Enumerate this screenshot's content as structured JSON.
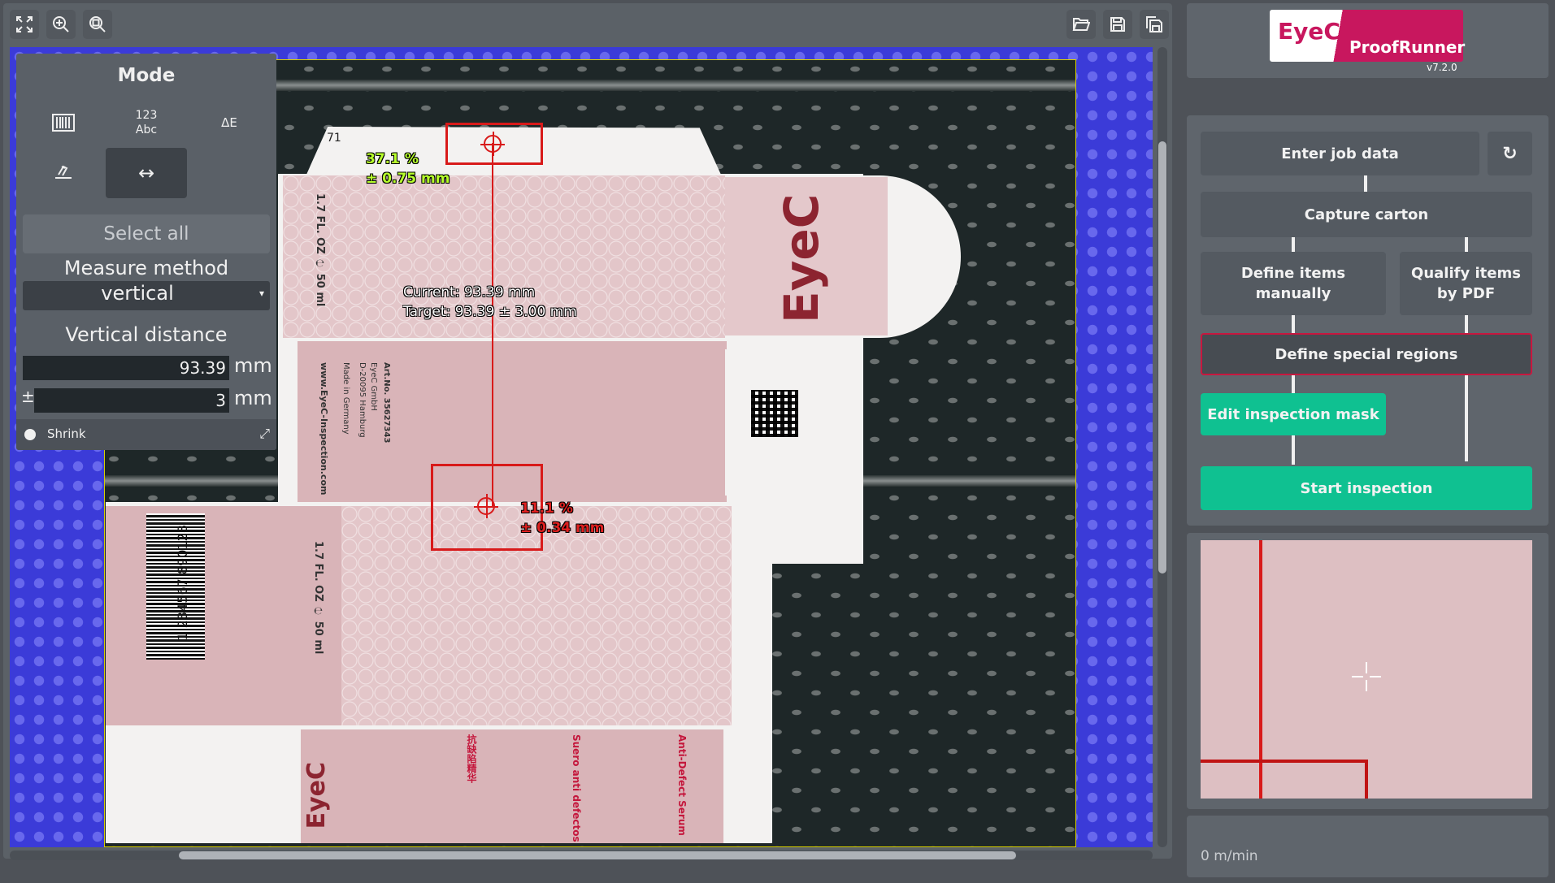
{
  "app": {
    "brand_left": "EyeC",
    "brand_right": "ProofRunner",
    "version": "v7.2.0"
  },
  "toolbar": {
    "left_icons": [
      "fullscreen-icon",
      "zoom-in-icon",
      "zoom-fit-icon"
    ],
    "right_icons": [
      "open-folder-icon",
      "save-icon",
      "save-as-icon"
    ]
  },
  "mode_panel": {
    "title": "Mode",
    "tools": [
      {
        "name": "barcode-mode-icon",
        "label": ""
      },
      {
        "name": "text-mode-icon",
        "label_top": "123",
        "label_bottom": "Abc"
      },
      {
        "name": "color-delta-e-icon",
        "label": "ΔE"
      },
      {
        "name": "brush-mode-icon",
        "label": ""
      },
      {
        "name": "measure-mode-icon",
        "label": "↔",
        "selected": true
      }
    ],
    "select_all": "Select all",
    "measure_method_label": "Measure method",
    "measure_method_value": "vertical",
    "vertical_distance_label": "Vertical distance",
    "distance_value": "93.39",
    "distance_unit": "mm",
    "tolerance_prefix": "±",
    "tolerance_value": "3",
    "tolerance_unit": "mm",
    "shrink_label": "Shrink"
  },
  "overlay": {
    "top_percent": "37.1 %",
    "top_tol": "± 0.75 mm",
    "bottom_percent": "11.1 %",
    "bottom_tol": "± 0.34 mm",
    "current": "Current: 93.39 mm",
    "target": "Target: 93.39 ± 3.00 mm",
    "panel_number": "71"
  },
  "carton_text": {
    "volume": "1.7 FL. OZ ℮ 50 ml",
    "art_no": "Art.No. 35627343",
    "company": "EyeC GmbH",
    "city": "D-20095 Hamburg",
    "made_in": "Made in Germany",
    "website": "www.EyeC-Inspection.com",
    "barcode_number": "1 234567 890128",
    "product_en": "Anti-Defect Serum",
    "product_es": "Suero anti defectos",
    "product_cn": "抗缺陷精华",
    "logo": "EyeC"
  },
  "workflow": {
    "enter_job_data": "Enter job data",
    "capture_carton": "Capture carton",
    "define_manual": "Define items manually",
    "qualify_pdf": "Qualify items by PDF",
    "define_special": "Define special regions",
    "edit_mask": "Edit inspection mask",
    "start_inspection": "Start inspection",
    "refresh_icon": "refresh-icon"
  },
  "status": {
    "speed": "0 m/min"
  },
  "colors": {
    "accent_green": "#0fc191",
    "alert_red": "#d81a1a",
    "active_border": "#c8173f",
    "brand_magenta": "#c8175e"
  }
}
